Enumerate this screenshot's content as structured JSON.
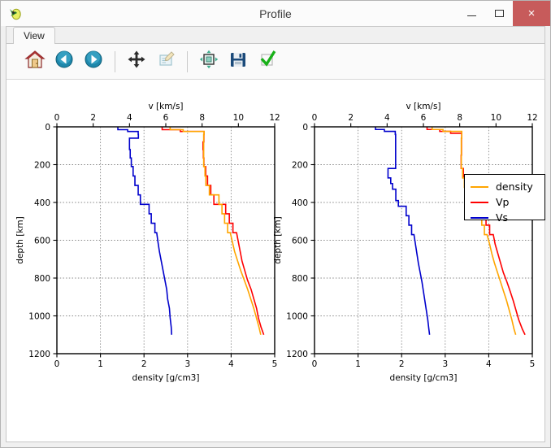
{
  "window": {
    "title": "Profile",
    "icon": "app-icon",
    "controls": {
      "minimize": "minimize-button",
      "maximize": "maximize-button",
      "close": "close-button",
      "close_glyph": "×"
    }
  },
  "tabs": [
    {
      "label": "View",
      "active": true
    }
  ],
  "toolbar": {
    "buttons": [
      {
        "name": "home-icon",
        "tooltip": "Home"
      },
      {
        "name": "back-arrow-icon",
        "tooltip": "Back"
      },
      {
        "name": "forward-arrow-icon",
        "tooltip": "Forward"
      },
      {
        "name": "pan-move-icon",
        "tooltip": "Pan"
      },
      {
        "name": "zoom-rect-icon",
        "tooltip": "Zoom to rectangle"
      },
      {
        "name": "configure-subplots-icon",
        "tooltip": "Configure subplots"
      },
      {
        "name": "save-floppy-icon",
        "tooltip": "Save figure"
      },
      {
        "name": "apply-check-icon",
        "tooltip": "Apply"
      }
    ],
    "separators": [
      3,
      5
    ]
  },
  "legend": {
    "entries": [
      {
        "label": "density",
        "color": "#ffa500"
      },
      {
        "label": "Vp",
        "color": "#ff0000"
      },
      {
        "label": "Vs",
        "color": "#0000cc"
      }
    ]
  },
  "chart_data": [
    {
      "id": "left-profile",
      "type": "line",
      "title": "",
      "xlabel": "density [g/cm3]",
      "xlabel_top": "v [km/s]",
      "ylabel": "depth [km]",
      "xlim_top": [
        0,
        12
      ],
      "xlim_bottom": [
        0,
        5
      ],
      "ylim": [
        1200,
        0
      ],
      "xticks_top": [
        0,
        2,
        4,
        6,
        8,
        10,
        12
      ],
      "xticks_bottom": [
        0,
        1,
        2,
        3,
        4,
        5
      ],
      "yticks": [
        0,
        200,
        400,
        600,
        800,
        1000,
        1200
      ],
      "grid": true,
      "legend_position": "figure-top-right",
      "series": [
        {
          "name": "Vs",
          "color": "#0000cc",
          "axis": "top",
          "units": "km/s",
          "points": [
            [
              3.36,
              0
            ],
            [
              3.36,
              15
            ],
            [
              3.9,
              15
            ],
            [
              3.9,
              24.4
            ],
            [
              4.48,
              24.4
            ],
            [
              4.48,
              40
            ],
            [
              4.49,
              40
            ],
            [
              4.49,
              60
            ],
            [
              4.0,
              60
            ],
            [
              4.0,
              80
            ],
            [
              4.0,
              120
            ],
            [
              4.04,
              120
            ],
            [
              4.04,
              165
            ],
            [
              4.1,
              165
            ],
            [
              4.1,
              210
            ],
            [
              4.2,
              210
            ],
            [
              4.2,
              260
            ],
            [
              4.3,
              260
            ],
            [
              4.3,
              310
            ],
            [
              4.48,
              310
            ],
            [
              4.48,
              360
            ],
            [
              4.6,
              360
            ],
            [
              4.6,
              410
            ],
            [
              5.08,
              410
            ],
            [
              5.08,
              460
            ],
            [
              5.2,
              460
            ],
            [
              5.2,
              510
            ],
            [
              5.4,
              510
            ],
            [
              5.4,
              560
            ],
            [
              5.5,
              560
            ],
            [
              5.57,
              610
            ],
            [
              5.65,
              660
            ],
            [
              5.75,
              710
            ],
            [
              5.85,
              760
            ],
            [
              5.95,
              810
            ],
            [
              6.05,
              860
            ],
            [
              6.1,
              910
            ],
            [
              6.2,
              960
            ],
            [
              6.24,
              1010
            ],
            [
              6.3,
              1060
            ],
            [
              6.32,
              1100
            ]
          ]
        },
        {
          "name": "Vp",
          "color": "#ff0000",
          "axis": "top",
          "units": "km/s",
          "points": [
            [
              5.8,
              0
            ],
            [
              5.8,
              15
            ],
            [
              6.8,
              15
            ],
            [
              6.8,
              24.4
            ],
            [
              8.11,
              24.4
            ],
            [
              8.11,
              40
            ],
            [
              8.1,
              40
            ],
            [
              8.1,
              80
            ],
            [
              8.05,
              80
            ],
            [
              8.05,
              120
            ],
            [
              8.07,
              120
            ],
            [
              8.07,
              165
            ],
            [
              8.1,
              165
            ],
            [
              8.1,
              210
            ],
            [
              8.2,
              210
            ],
            [
              8.2,
              260
            ],
            [
              8.3,
              260
            ],
            [
              8.3,
              310
            ],
            [
              8.48,
              310
            ],
            [
              8.48,
              360
            ],
            [
              8.65,
              360
            ],
            [
              8.65,
              410
            ],
            [
              9.3,
              410
            ],
            [
              9.3,
              460
            ],
            [
              9.5,
              460
            ],
            [
              9.5,
              510
            ],
            [
              9.7,
              510
            ],
            [
              9.7,
              560
            ],
            [
              9.9,
              560
            ],
            [
              10.0,
              610
            ],
            [
              10.1,
              660
            ],
            [
              10.2,
              710
            ],
            [
              10.35,
              760
            ],
            [
              10.5,
              810
            ],
            [
              10.7,
              860
            ],
            [
              10.85,
              910
            ],
            [
              11.0,
              960
            ],
            [
              11.1,
              1010
            ],
            [
              11.25,
              1060
            ],
            [
              11.4,
              1100
            ]
          ]
        },
        {
          "name": "density",
          "color": "#ffa500",
          "axis": "bottom",
          "units": "g/cm3",
          "points": [
            [
              2.6,
              0
            ],
            [
              2.6,
              15
            ],
            [
              2.9,
              15
            ],
            [
              2.9,
              24.4
            ],
            [
              3.38,
              24.4
            ],
            [
              3.38,
              40
            ],
            [
              3.37,
              40
            ],
            [
              3.37,
              80
            ],
            [
              3.37,
              120
            ],
            [
              3.37,
              165
            ],
            [
              3.37,
              210
            ],
            [
              3.4,
              210
            ],
            [
              3.4,
              260
            ],
            [
              3.42,
              260
            ],
            [
              3.42,
              310
            ],
            [
              3.5,
              310
            ],
            [
              3.5,
              360
            ],
            [
              3.72,
              360
            ],
            [
              3.72,
              410
            ],
            [
              3.79,
              410
            ],
            [
              3.79,
              460
            ],
            [
              3.85,
              460
            ],
            [
              3.85,
              510
            ],
            [
              3.92,
              510
            ],
            [
              3.92,
              560
            ],
            [
              3.98,
              560
            ],
            [
              4.03,
              610
            ],
            [
              4.08,
              660
            ],
            [
              4.15,
              710
            ],
            [
              4.22,
              760
            ],
            [
              4.3,
              810
            ],
            [
              4.38,
              860
            ],
            [
              4.45,
              910
            ],
            [
              4.52,
              960
            ],
            [
              4.58,
              1010
            ],
            [
              4.64,
              1060
            ],
            [
              4.68,
              1100
            ]
          ]
        }
      ]
    },
    {
      "id": "right-profile",
      "type": "line",
      "title": "",
      "xlabel": "density [g/cm3]",
      "xlabel_top": "v [km/s]",
      "ylabel": "depth [km]",
      "xlim_top": [
        0,
        12
      ],
      "xlim_bottom": [
        0,
        5
      ],
      "ylim": [
        1200,
        0
      ],
      "xticks_top": [
        0,
        2,
        4,
        6,
        8,
        10,
        12
      ],
      "xticks_bottom": [
        0,
        1,
        2,
        3,
        4,
        5
      ],
      "yticks": [
        0,
        200,
        400,
        600,
        800,
        1000,
        1200
      ],
      "grid": true,
      "series": [
        {
          "name": "Vs",
          "color": "#0000cc",
          "axis": "top",
          "units": "km/s",
          "points": [
            [
              3.36,
              0
            ],
            [
              3.36,
              14
            ],
            [
              3.85,
              14
            ],
            [
              3.85,
              24
            ],
            [
              4.45,
              24
            ],
            [
              4.45,
              40
            ],
            [
              4.47,
              40
            ],
            [
              4.47,
              220
            ],
            [
              4.05,
              220
            ],
            [
              4.05,
              270
            ],
            [
              4.2,
              270
            ],
            [
              4.2,
              300
            ],
            [
              4.3,
              300
            ],
            [
              4.3,
              330
            ],
            [
              4.48,
              330
            ],
            [
              4.48,
              390
            ],
            [
              4.62,
              390
            ],
            [
              4.62,
              420
            ],
            [
              5.05,
              420
            ],
            [
              5.05,
              470
            ],
            [
              5.2,
              470
            ],
            [
              5.2,
              520
            ],
            [
              5.35,
              520
            ],
            [
              5.35,
              570
            ],
            [
              5.48,
              570
            ],
            [
              5.56,
              620
            ],
            [
              5.64,
              670
            ],
            [
              5.72,
              720
            ],
            [
              5.82,
              770
            ],
            [
              5.92,
              820
            ],
            [
              6.0,
              870
            ],
            [
              6.08,
              920
            ],
            [
              6.16,
              970
            ],
            [
              6.24,
              1020
            ],
            [
              6.3,
              1070
            ],
            [
              6.34,
              1100
            ]
          ]
        },
        {
          "name": "Vp",
          "color": "#ff0000",
          "axis": "top",
          "units": "km/s",
          "points": [
            [
              6.2,
              0
            ],
            [
              6.2,
              14
            ],
            [
              6.9,
              14
            ],
            [
              6.9,
              24
            ],
            [
              7.5,
              24
            ],
            [
              7.5,
              34
            ],
            [
              8.11,
              34
            ],
            [
              8.11,
              60
            ],
            [
              8.1,
              60
            ],
            [
              8.1,
              150
            ],
            [
              8.08,
              150
            ],
            [
              8.08,
              220
            ],
            [
              8.2,
              220
            ],
            [
              8.2,
              270
            ],
            [
              8.35,
              270
            ],
            [
              8.35,
              300
            ],
            [
              8.45,
              300
            ],
            [
              8.45,
              340
            ],
            [
              8.6,
              340
            ],
            [
              8.6,
              400
            ],
            [
              8.9,
              400
            ],
            [
              8.9,
              420
            ],
            [
              9.3,
              420
            ],
            [
              9.3,
              470
            ],
            [
              9.45,
              470
            ],
            [
              9.45,
              520
            ],
            [
              9.65,
              520
            ],
            [
              9.65,
              570
            ],
            [
              9.85,
              570
            ],
            [
              9.95,
              620
            ],
            [
              10.1,
              670
            ],
            [
              10.25,
              720
            ],
            [
              10.4,
              770
            ],
            [
              10.6,
              820
            ],
            [
              10.78,
              870
            ],
            [
              10.95,
              920
            ],
            [
              11.1,
              970
            ],
            [
              11.25,
              1020
            ],
            [
              11.45,
              1070
            ],
            [
              11.6,
              1100
            ]
          ]
        },
        {
          "name": "density",
          "color": "#ffa500",
          "axis": "bottom",
          "units": "g/cm3",
          "points": [
            [
              2.7,
              0
            ],
            [
              2.7,
              14
            ],
            [
              2.95,
              14
            ],
            [
              2.95,
              24
            ],
            [
              3.38,
              24
            ],
            [
              3.38,
              60
            ],
            [
              3.37,
              60
            ],
            [
              3.37,
              220
            ],
            [
              3.4,
              220
            ],
            [
              3.4,
              270
            ],
            [
              3.44,
              270
            ],
            [
              3.44,
              320
            ],
            [
              3.52,
              320
            ],
            [
              3.52,
              380
            ],
            [
              3.7,
              380
            ],
            [
              3.7,
              420
            ],
            [
              3.78,
              420
            ],
            [
              3.78,
              470
            ],
            [
              3.84,
              470
            ],
            [
              3.84,
              520
            ],
            [
              3.9,
              520
            ],
            [
              3.9,
              570
            ],
            [
              3.96,
              570
            ],
            [
              4.02,
              620
            ],
            [
              4.07,
              670
            ],
            [
              4.13,
              720
            ],
            [
              4.2,
              770
            ],
            [
              4.27,
              820
            ],
            [
              4.34,
              870
            ],
            [
              4.41,
              920
            ],
            [
              4.47,
              970
            ],
            [
              4.53,
              1020
            ],
            [
              4.58,
              1070
            ],
            [
              4.62,
              1100
            ]
          ]
        }
      ]
    }
  ]
}
